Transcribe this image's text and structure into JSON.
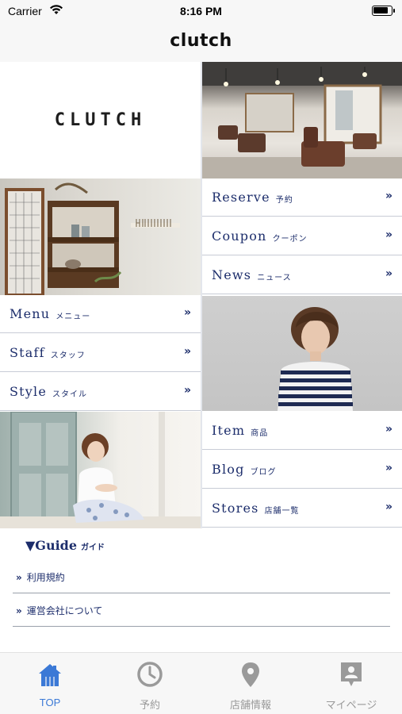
{
  "status_bar": {
    "carrier": "Carrier",
    "time": "8:16 PM",
    "battery_level": 0.85
  },
  "nav": {
    "title": "clutch"
  },
  "logo": {
    "text": "CLUTCH"
  },
  "menu": {
    "reserve": {
      "label": "Reserve",
      "sub": "予約",
      "chevron": "»"
    },
    "coupon": {
      "label": "Coupon",
      "sub": "クーポン",
      "chevron": "»"
    },
    "news": {
      "label": "News",
      "sub": "ニュース",
      "chevron": "»"
    },
    "menu": {
      "label": "Menu",
      "sub": "メニュー",
      "chevron": "»"
    },
    "staff": {
      "label": "Staff",
      "sub": "スタッフ",
      "chevron": "»"
    },
    "style": {
      "label": "Style",
      "sub": "スタイル",
      "chevron": "»"
    },
    "item": {
      "label": "Item",
      "sub": "商品",
      "chevron": "»"
    },
    "blog": {
      "label": "Blog",
      "sub": "ブログ",
      "chevron": "»"
    },
    "stores": {
      "label": "Stores",
      "sub": "店舗一覧",
      "chevron": "»"
    }
  },
  "guide": {
    "title": "▼Guide",
    "sub": "ガイド",
    "items": [
      {
        "mark": "»",
        "label": "利用規約"
      },
      {
        "mark": "»",
        "label": "運営会社について"
      }
    ]
  },
  "tabs": [
    {
      "label": "TOP",
      "icon": "home-icon",
      "active": true
    },
    {
      "label": "予約",
      "icon": "clock-icon",
      "active": false
    },
    {
      "label": "店舗情報",
      "icon": "location-pin-icon",
      "active": false
    },
    {
      "label": "マイページ",
      "icon": "person-card-icon",
      "active": false
    }
  ],
  "colors": {
    "accent": "#3b79d6",
    "menu_text": "#1c2d6b",
    "inactive_tab": "#9a9a9a"
  }
}
